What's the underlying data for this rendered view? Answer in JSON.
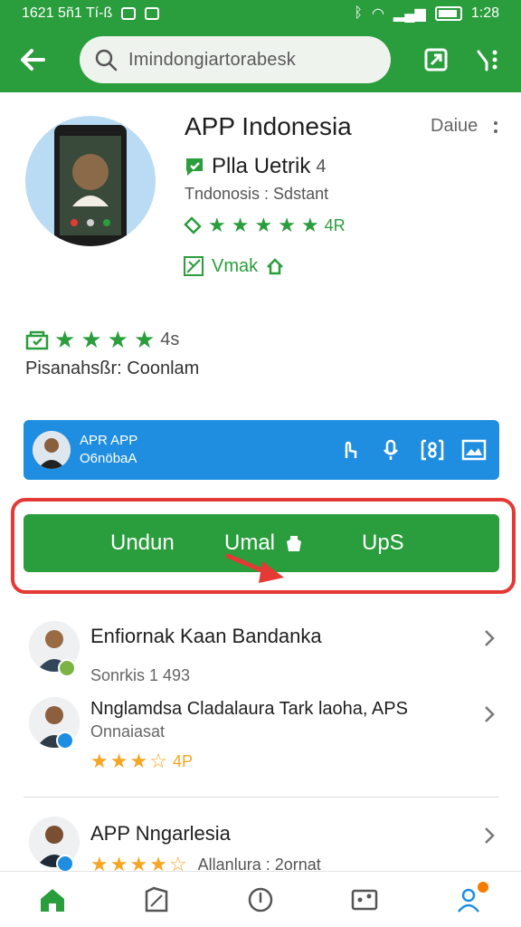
{
  "colors": {
    "primary": "#2a9d3c",
    "banner": "#1f8ee0",
    "highlight": "#e53935",
    "star_orange": "#f5a623"
  },
  "status_bar": {
    "left_text": "1621 5ñ1 Tí-ß",
    "time": "1:28"
  },
  "search": {
    "text": "Imindongiartorabesk"
  },
  "app": {
    "title": "APP Indonesia",
    "date": "Daiue",
    "developer": "Plla Uetrik",
    "developer_suffix": "4",
    "category": "Tndonosis : Sdstant",
    "rating_text": "4R",
    "verified_label": "Vmak"
  },
  "summary": {
    "rating_text": "4s",
    "description": "Pisanahsßr: Coonlam"
  },
  "banner": {
    "line1": "APR APP",
    "line2": "O6nöbaA"
  },
  "download": {
    "left_label": "Undun",
    "middle_label": "Umal",
    "right_label": "UpS"
  },
  "list": [
    {
      "title": "Enfiornak Kaan Bandanka",
      "subtitle": "Sonrkis 1 493"
    },
    {
      "title": "Nnglamdsa Cladalaura Tark laoha, APS",
      "subtitle": "Onnaiasat",
      "rating_text": "4P"
    },
    {
      "title": "APP Nngarlesia",
      "subtitle": "Allanlura : 2ornat"
    }
  ],
  "bottom_nav": [
    "home-icon",
    "tag-icon",
    "compass-icon",
    "picture-icon",
    "profile-icon"
  ]
}
